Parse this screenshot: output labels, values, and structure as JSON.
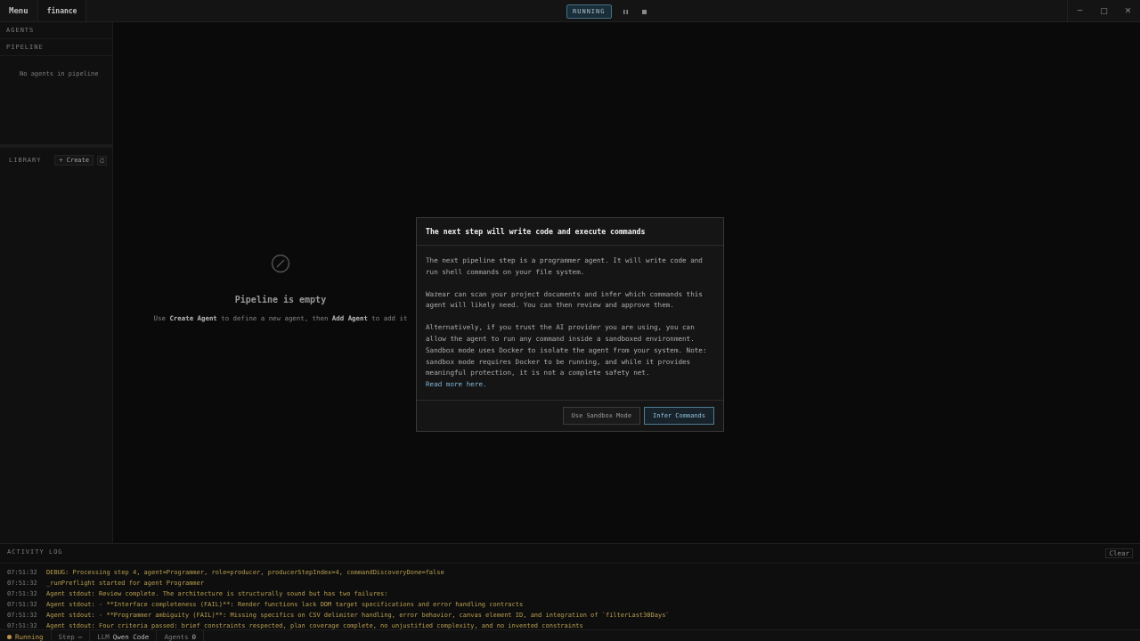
{
  "top_bar": {
    "menu": "Menu",
    "tabs": [
      {
        "label": "finance",
        "selected": true
      }
    ],
    "run_status": "RUNNING",
    "window_controls": [
      "─",
      "□",
      "✕"
    ]
  },
  "sidebar": {
    "agents_header": "AGENTS",
    "pipeline_header": "PIPELINE",
    "pipeline_empty": "No agents in pipeline",
    "library_header": "LIBRARY",
    "create_button": "+ Create"
  },
  "empty_state": {
    "title": "Pipeline is empty",
    "description": "Use **Create Agent** to define a new agent, then **Add Agent** to add it"
  },
  "modal": {
    "title": "The next step will write code and execute commands",
    "paragraphs": [
      {
        "text": "The next pipeline step is a programmer agent. It will write code and run shell commands on your file system."
      },
      {
        "text": "Wazear can scan your project documents and infer which commands this agent will likely need. You can then review and approve them."
      },
      {
        "text": "Alternatively, if you trust the AI provider you are using, you can allow the agent to run any command inside a sandboxed environment. Sandbox mode uses Docker to isolate the agent from your system. Note: sandbox mode requires Docker to be running, and while it provides meaningful protection, it is not a complete safety net.",
        "link": "Read more here."
      }
    ],
    "buttons": [
      {
        "label": "Use Sandbox Mode",
        "kind": "secondary"
      },
      {
        "label": "Infer Commands",
        "kind": "primary"
      }
    ]
  },
  "activity_log": {
    "title": "ACTIVITY LOG",
    "clear": "Clear",
    "entries": [
      {
        "time": "07:51:32",
        "message": "DEBUG: Processing step 4, agent=Programmer, role=producer, producerStepIndex=4, commandDiscoveryDone=false"
      },
      {
        "time": "07:51:32",
        "message": "_runPreflight started for agent Programmer"
      },
      {
        "time": "07:51:32",
        "message": "Agent stdout: Review complete. The architecture is structurally sound but has two failures:"
      },
      {
        "time": "07:51:32",
        "message": "Agent stdout: - **Interface completeness (FAIL)**: Render functions lack DOM target specifications and error handling contracts"
      },
      {
        "time": "07:51:32",
        "message": "Agent stdout: - **Programmer ambiguity (FAIL)**: Missing specifics on CSV delimiter handling, error behavior, canvas element ID, and integration of `filterLast30Days`"
      },
      {
        "time": "07:51:32",
        "message": "Agent stdout: Four criteria passed: brief constraints respected, plan coverage complete, no unjustified complexity, and no invented constraints"
      }
    ]
  },
  "status_bar": [
    {
      "kind": "status",
      "value": "Running"
    },
    {
      "kind": "field",
      "label": "Step",
      "value": "—"
    },
    {
      "kind": "field",
      "label": "LLM",
      "value": "Qwen Code"
    },
    {
      "kind": "field",
      "label": "Agents",
      "value": "0"
    }
  ]
}
